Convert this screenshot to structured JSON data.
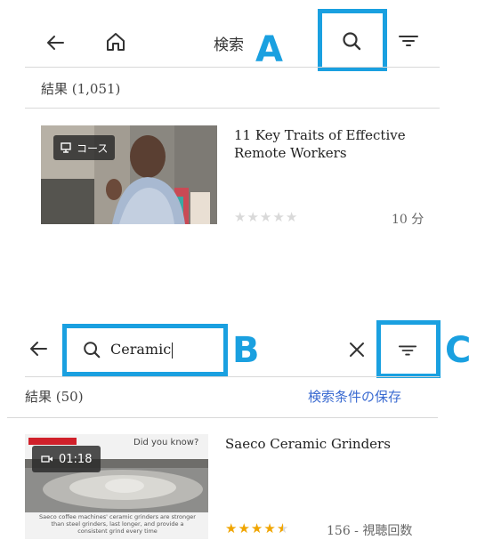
{
  "top": {
    "title": "検索",
    "marker_a": "A",
    "results_label": "結果 (1,051)",
    "course": {
      "badge": "コース",
      "title": "11 Key Traits of Effective Remote Workers",
      "duration": "10 分",
      "rating_stars": 0
    }
  },
  "bottom": {
    "search_value": "Ceramic",
    "marker_b": "B",
    "marker_c": "C",
    "results_label": "結果 (50)",
    "save_search": "検索条件の保存",
    "video": {
      "duration": "01:18",
      "thumb_text_top": "Did you know?",
      "thumb_text_bottom": "Saeco coffee machines' ceramic grinders are stronger than steel grinders, last longer, and provide a consistent grind every time",
      "title": "Saeco Ceramic Grinders",
      "rating_stars": 4.5,
      "views": "156 - 視聴回数"
    }
  },
  "colors": {
    "highlight": "#1aa0e0",
    "link": "#3b6bd1",
    "star_filled": "#f0a500",
    "star_empty": "#d9d9d9"
  },
  "icons": [
    "back-arrow-icon",
    "home-icon",
    "search-icon",
    "filter-icon",
    "close-icon",
    "course-icon",
    "video-icon",
    "star-icon"
  ]
}
